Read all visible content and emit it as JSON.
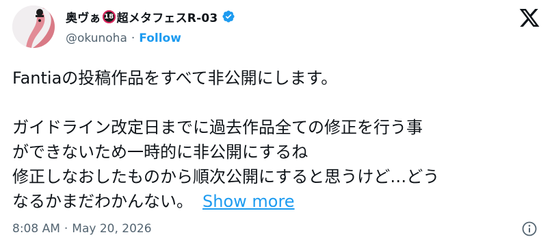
{
  "author": {
    "display_name": "奥ヴぁ",
    "age_badge": "18",
    "display_name_suffix": "超メタフェスR-03",
    "handle": "@okunoha",
    "separator": "·",
    "follow_label": "Follow"
  },
  "tweet": {
    "line1": "Fantiaの投稿作品をすべて非公開にします。",
    "line2": "ガイドライン改定日までに過去作品全ての修正を行う事",
    "line3": "ができないため一時的に非公開にするね",
    "line4": "修正しなおしたものから順次公開にすると思うけど…どう",
    "line5": "なるかまだわかんない。",
    "show_more": "Show more"
  },
  "meta": {
    "time": "8:08 AM",
    "separator": "·",
    "date": "May 20, 2026"
  },
  "colors": {
    "accent": "#1d9bf0",
    "muted": "#536471",
    "text": "#0f1419"
  },
  "icons": {
    "verified": "verified-badge-icon",
    "platform": "x-logo-icon",
    "info": "info-icon"
  }
}
